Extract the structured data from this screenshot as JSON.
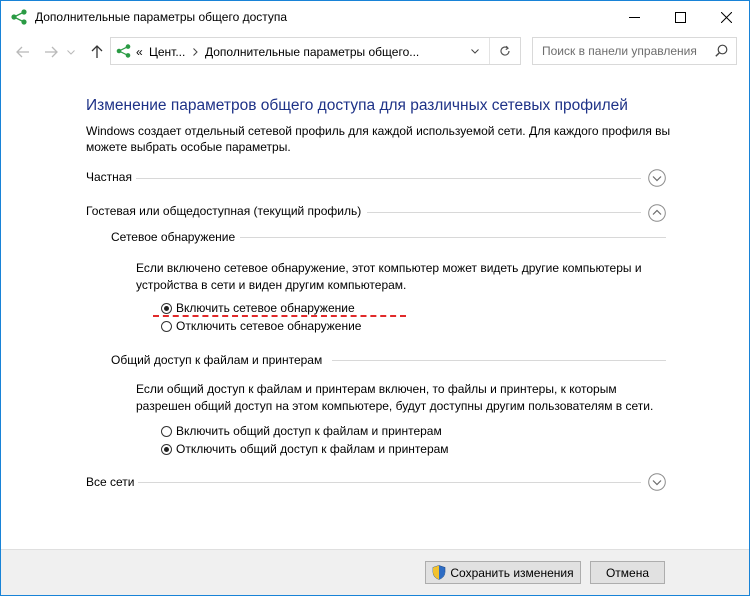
{
  "window": {
    "title": "Дополнительные параметры общего доступа"
  },
  "nav": {
    "crumb_prefix": "«",
    "crumb_1": "Цент...",
    "crumb_2": "Дополнительные параметры общего...",
    "search_placeholder": "Поиск в панели управления"
  },
  "main": {
    "heading": "Изменение параметров общего доступа для различных сетевых профилей",
    "description": "Windows создает отдельный сетевой профиль для каждой используемой сети. Для каждого профиля вы можете выбрать особые параметры.",
    "profiles": {
      "private": {
        "label": "Частная",
        "expanded": false
      },
      "guest": {
        "label": "Гостевая или общедоступная (текущий профиль)",
        "expanded": true
      },
      "all": {
        "label": "Все сети",
        "expanded": false
      }
    },
    "network_discovery": {
      "title": "Сетевое обнаружение",
      "text": "Если включено сетевое обнаружение, этот компьютер может видеть другие компьютеры и устройства в сети и виден другим компьютерам.",
      "option_on": "Включить сетевое обнаружение",
      "option_off": "Отключить сетевое обнаружение",
      "selected": "on"
    },
    "file_sharing": {
      "title": "Общий доступ к файлам и принтерам",
      "text": "Если общий доступ к файлам и принтерам включен, то файлы и принтеры, к которым разрешен общий доступ на этом компьютере, будут доступны другим пользователям в сети.",
      "option_on": "Включить общий доступ к файлам и принтерам",
      "option_off": "Отключить общий доступ к файлам и принтерам",
      "selected": "off"
    }
  },
  "footer": {
    "save_label": "Сохранить изменения",
    "cancel_label": "Отмена"
  },
  "colors": {
    "heading": "#1e3287",
    "annotation": "#e12a2a",
    "window_border": "#1883d7"
  }
}
